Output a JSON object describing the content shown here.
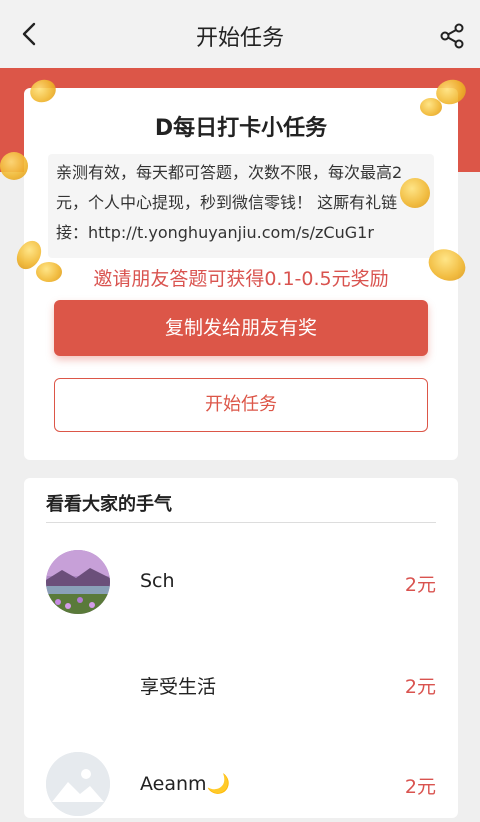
{
  "header": {
    "title": "开始任务"
  },
  "task": {
    "title": "D每日打卡小任务",
    "description": "亲测有效，每天都可答题，次数不限，每次最高2元，个人中心提现，秒到微信零钱！ 这厮有礼链接：http://t.yonghuyanjiu.com/s/zCuG1r",
    "invite_text": "邀请朋友答题可获得0.1-0.5元奖励",
    "copy_button": "复制发给朋友有奖",
    "start_button": "开始任务"
  },
  "luck": {
    "title": "看看大家的手气",
    "items": [
      {
        "name": "Sch",
        "amount": "2元"
      },
      {
        "name": "享受生活",
        "amount": "2元"
      },
      {
        "name": "Aeanm🌙",
        "amount": "2元"
      }
    ]
  },
  "colors": {
    "accent": "#dc5648",
    "background": "#efefef"
  }
}
